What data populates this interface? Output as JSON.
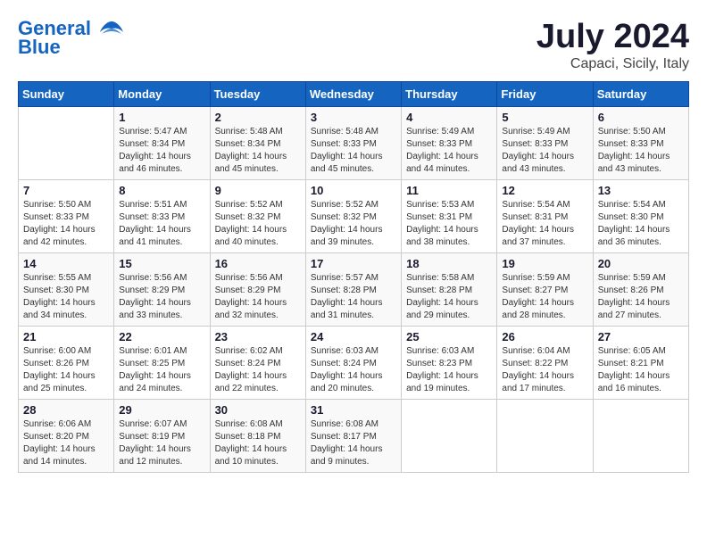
{
  "logo": {
    "line1": "General",
    "line2": "Blue"
  },
  "title": "July 2024",
  "location": "Capaci, Sicily, Italy",
  "days_of_week": [
    "Sunday",
    "Monday",
    "Tuesday",
    "Wednesday",
    "Thursday",
    "Friday",
    "Saturday"
  ],
  "weeks": [
    [
      {
        "day": "",
        "info": ""
      },
      {
        "day": "1",
        "info": "Sunrise: 5:47 AM\nSunset: 8:34 PM\nDaylight: 14 hours\nand 46 minutes."
      },
      {
        "day": "2",
        "info": "Sunrise: 5:48 AM\nSunset: 8:34 PM\nDaylight: 14 hours\nand 45 minutes."
      },
      {
        "day": "3",
        "info": "Sunrise: 5:48 AM\nSunset: 8:33 PM\nDaylight: 14 hours\nand 45 minutes."
      },
      {
        "day": "4",
        "info": "Sunrise: 5:49 AM\nSunset: 8:33 PM\nDaylight: 14 hours\nand 44 minutes."
      },
      {
        "day": "5",
        "info": "Sunrise: 5:49 AM\nSunset: 8:33 PM\nDaylight: 14 hours\nand 43 minutes."
      },
      {
        "day": "6",
        "info": "Sunrise: 5:50 AM\nSunset: 8:33 PM\nDaylight: 14 hours\nand 43 minutes."
      }
    ],
    [
      {
        "day": "7",
        "info": "Sunrise: 5:50 AM\nSunset: 8:33 PM\nDaylight: 14 hours\nand 42 minutes."
      },
      {
        "day": "8",
        "info": "Sunrise: 5:51 AM\nSunset: 8:33 PM\nDaylight: 14 hours\nand 41 minutes."
      },
      {
        "day": "9",
        "info": "Sunrise: 5:52 AM\nSunset: 8:32 PM\nDaylight: 14 hours\nand 40 minutes."
      },
      {
        "day": "10",
        "info": "Sunrise: 5:52 AM\nSunset: 8:32 PM\nDaylight: 14 hours\nand 39 minutes."
      },
      {
        "day": "11",
        "info": "Sunrise: 5:53 AM\nSunset: 8:31 PM\nDaylight: 14 hours\nand 38 minutes."
      },
      {
        "day": "12",
        "info": "Sunrise: 5:54 AM\nSunset: 8:31 PM\nDaylight: 14 hours\nand 37 minutes."
      },
      {
        "day": "13",
        "info": "Sunrise: 5:54 AM\nSunset: 8:30 PM\nDaylight: 14 hours\nand 36 minutes."
      }
    ],
    [
      {
        "day": "14",
        "info": "Sunrise: 5:55 AM\nSunset: 8:30 PM\nDaylight: 14 hours\nand 34 minutes."
      },
      {
        "day": "15",
        "info": "Sunrise: 5:56 AM\nSunset: 8:29 PM\nDaylight: 14 hours\nand 33 minutes."
      },
      {
        "day": "16",
        "info": "Sunrise: 5:56 AM\nSunset: 8:29 PM\nDaylight: 14 hours\nand 32 minutes."
      },
      {
        "day": "17",
        "info": "Sunrise: 5:57 AM\nSunset: 8:28 PM\nDaylight: 14 hours\nand 31 minutes."
      },
      {
        "day": "18",
        "info": "Sunrise: 5:58 AM\nSunset: 8:28 PM\nDaylight: 14 hours\nand 29 minutes."
      },
      {
        "day": "19",
        "info": "Sunrise: 5:59 AM\nSunset: 8:27 PM\nDaylight: 14 hours\nand 28 minutes."
      },
      {
        "day": "20",
        "info": "Sunrise: 5:59 AM\nSunset: 8:26 PM\nDaylight: 14 hours\nand 27 minutes."
      }
    ],
    [
      {
        "day": "21",
        "info": "Sunrise: 6:00 AM\nSunset: 8:26 PM\nDaylight: 14 hours\nand 25 minutes."
      },
      {
        "day": "22",
        "info": "Sunrise: 6:01 AM\nSunset: 8:25 PM\nDaylight: 14 hours\nand 24 minutes."
      },
      {
        "day": "23",
        "info": "Sunrise: 6:02 AM\nSunset: 8:24 PM\nDaylight: 14 hours\nand 22 minutes."
      },
      {
        "day": "24",
        "info": "Sunrise: 6:03 AM\nSunset: 8:24 PM\nDaylight: 14 hours\nand 20 minutes."
      },
      {
        "day": "25",
        "info": "Sunrise: 6:03 AM\nSunset: 8:23 PM\nDaylight: 14 hours\nand 19 minutes."
      },
      {
        "day": "26",
        "info": "Sunrise: 6:04 AM\nSunset: 8:22 PM\nDaylight: 14 hours\nand 17 minutes."
      },
      {
        "day": "27",
        "info": "Sunrise: 6:05 AM\nSunset: 8:21 PM\nDaylight: 14 hours\nand 16 minutes."
      }
    ],
    [
      {
        "day": "28",
        "info": "Sunrise: 6:06 AM\nSunset: 8:20 PM\nDaylight: 14 hours\nand 14 minutes."
      },
      {
        "day": "29",
        "info": "Sunrise: 6:07 AM\nSunset: 8:19 PM\nDaylight: 14 hours\nand 12 minutes."
      },
      {
        "day": "30",
        "info": "Sunrise: 6:08 AM\nSunset: 8:18 PM\nDaylight: 14 hours\nand 10 minutes."
      },
      {
        "day": "31",
        "info": "Sunrise: 6:08 AM\nSunset: 8:17 PM\nDaylight: 14 hours\nand 9 minutes."
      },
      {
        "day": "",
        "info": ""
      },
      {
        "day": "",
        "info": ""
      },
      {
        "day": "",
        "info": ""
      }
    ]
  ]
}
